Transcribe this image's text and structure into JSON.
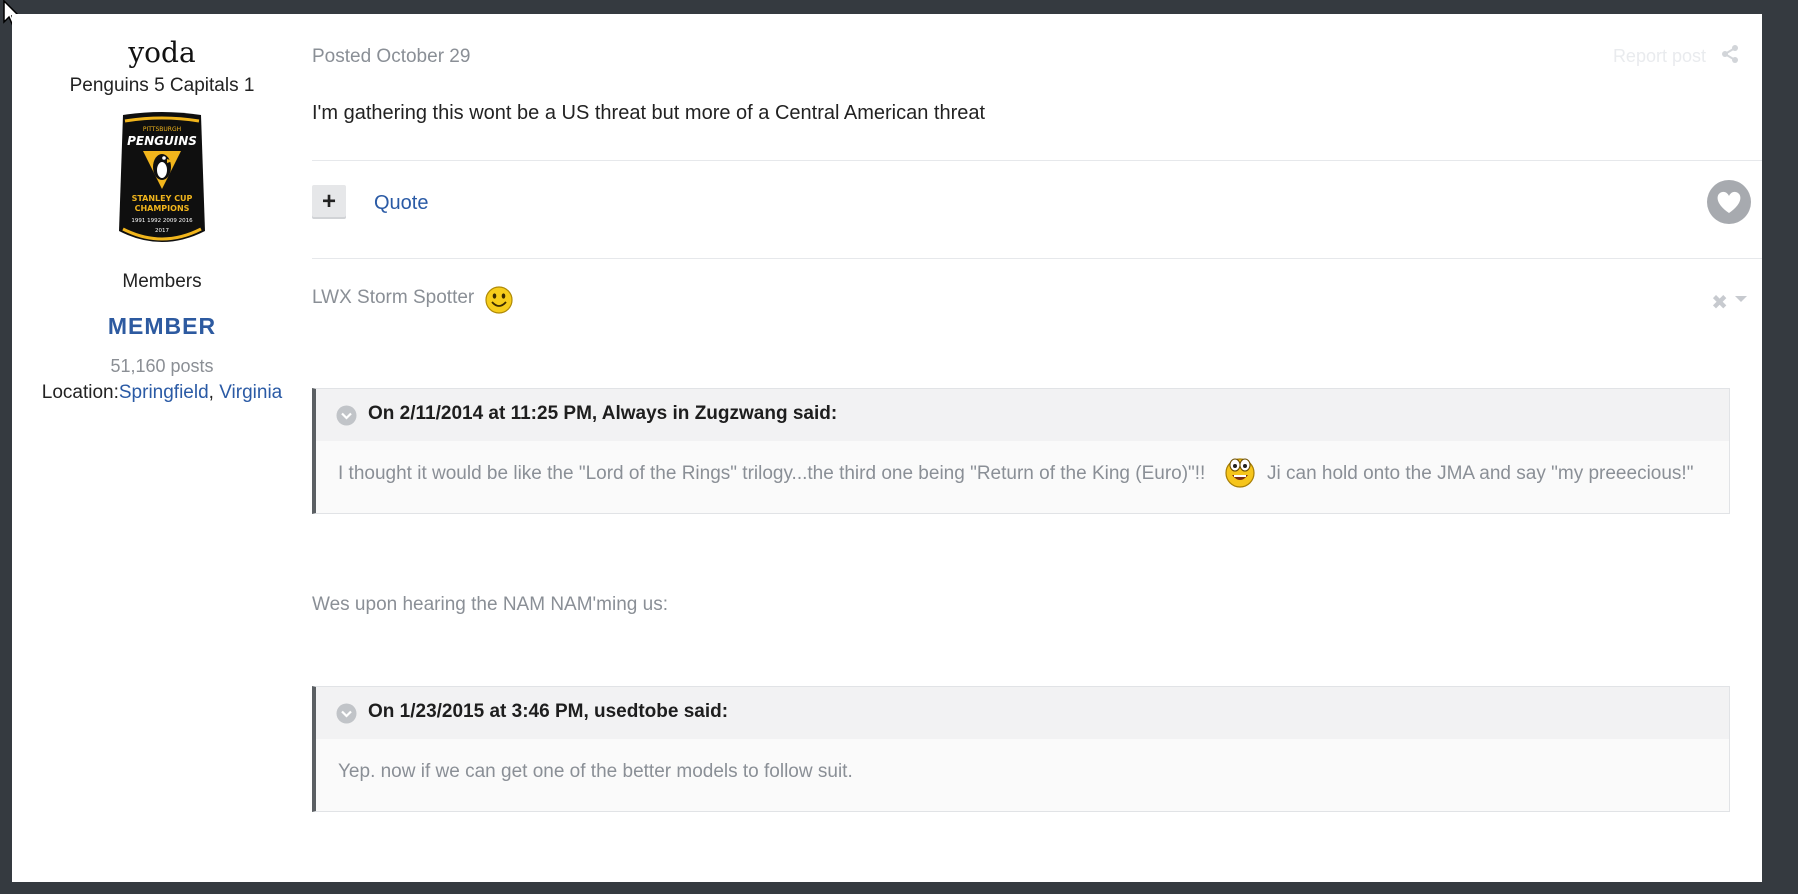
{
  "author": {
    "name": "yoda",
    "title": "Penguins 5 Capitals 1",
    "avatar_lines": [
      "PITTSBURGH",
      "PENGUINS",
      "STANLEY CUP",
      "CHAMPIONS",
      "1991 1992 2009 2016",
      "2017"
    ],
    "group": "Members",
    "rank": "MEMBER",
    "posts": "51,160 posts",
    "location_label": "Location:",
    "location_city": "Springfield",
    "location_sep": ", ",
    "location_state": "Virginia"
  },
  "post": {
    "posted": "Posted October 29",
    "report": "Report post",
    "content": "I'm gathering this wont be a US threat but more of a Central American threat",
    "plus_label": "+",
    "quote_label": "Quote"
  },
  "signature": {
    "text": "LWX Storm Spotter",
    "close_glyph": "✖"
  },
  "quotes": [
    {
      "cite": "On 2/11/2014 at 11:25 PM, Always in Zugzwang said:",
      "text": "I thought it would be like the \"Lord of the Rings\" trilogy...the third one being \"Return of the King (Euro)\"!!",
      "text_after": "Ji can hold onto the JMA and say \"my preeecious!\""
    },
    {
      "cite": "On 1/23/2015 at 3:46 PM, usedtobe said:",
      "text": "Yep. now if we can get one of the better models to follow suit."
    }
  ],
  "mid_text": "Wes upon hearing the NAM NAM'ming us:",
  "colors": {
    "background": "#353a40",
    "link": "#2a5aa5",
    "muted": "#8a8f96",
    "quote_border": "#5b5f63"
  }
}
